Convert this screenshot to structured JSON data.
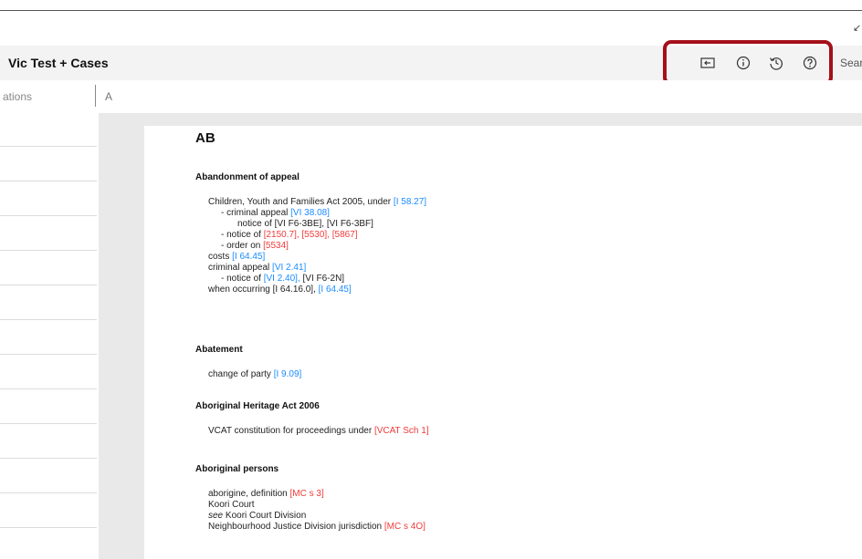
{
  "window": {
    "corner_glyph": "↙"
  },
  "header": {
    "title": "Vic Test + Cases",
    "search_placeholder": "Search"
  },
  "toolbar": {
    "icons": [
      "panel-toggle-icon",
      "info-icon",
      "history-icon",
      "help-icon"
    ],
    "highlight_color": "#a50f1a"
  },
  "tabs": {
    "left_label": "ations",
    "alpha_label": "A"
  },
  "colors": {
    "ref_blue": "#1a8cff",
    "ref_red": "#f23a3a"
  },
  "index": {
    "letter": "AB",
    "entries": [
      {
        "heading": "Abandonment of appeal",
        "lines": [
          {
            "indent": 0,
            "segments": [
              {
                "t": "Children, Youth and Families Act 2005, under "
              },
              {
                "t": "[I 58.27]",
                "c": "blue"
              }
            ]
          },
          {
            "indent": 1,
            "segments": [
              {
                "t": "- criminal appeal "
              },
              {
                "t": "[VI 38.08]",
                "c": "blue"
              }
            ]
          },
          {
            "indent": 2,
            "segments": [
              {
                "t": "notice of [VI F6-3BE], [VI F6-3BF]"
              }
            ]
          },
          {
            "indent": 1,
            "segments": [
              {
                "t": "- notice of "
              },
              {
                "t": "[2150.7],",
                "c": "red"
              },
              {
                "t": " "
              },
              {
                "t": "[5530],",
                "c": "red"
              },
              {
                "t": " "
              },
              {
                "t": "[5867]",
                "c": "red"
              }
            ]
          },
          {
            "indent": 1,
            "segments": [
              {
                "t": "- order on "
              },
              {
                "t": "[5534]",
                "c": "red"
              }
            ]
          },
          {
            "indent": 0,
            "segments": [
              {
                "t": "costs "
              },
              {
                "t": "[I 64.45]",
                "c": "blue"
              }
            ]
          },
          {
            "indent": 0,
            "segments": [
              {
                "t": "criminal appeal "
              },
              {
                "t": "[VI 2.41]",
                "c": "blue"
              }
            ]
          },
          {
            "indent": 1,
            "segments": [
              {
                "t": "- notice of "
              },
              {
                "t": "[VI 2.40],",
                "c": "blue"
              },
              {
                "t": " [VI F6-2N]"
              }
            ]
          },
          {
            "indent": 0,
            "segments": [
              {
                "t": "when occurring [I 64.16.0], "
              },
              {
                "t": "[I 64.45]",
                "c": "blue"
              }
            ]
          }
        ]
      },
      {
        "heading": "Abatement",
        "lines": [
          {
            "indent": 0,
            "segments": [
              {
                "t": "change of party "
              },
              {
                "t": "[I 9.09]",
                "c": "blue"
              }
            ]
          }
        ]
      },
      {
        "heading": "Aboriginal Heritage Act 2006",
        "lines": [
          {
            "indent": 0,
            "segments": [
              {
                "t": "VCAT constitution for proceedings under "
              },
              {
                "t": "[VCAT Sch 1]",
                "c": "red"
              }
            ]
          }
        ]
      },
      {
        "heading": "Aboriginal persons",
        "lines": [
          {
            "indent": 0,
            "segments": [
              {
                "t": "aborigine, definition "
              },
              {
                "t": "[MC s 3]",
                "c": "red"
              }
            ]
          },
          {
            "indent": 0,
            "segments": [
              {
                "t": "Koori Court"
              }
            ]
          },
          {
            "indent": 0,
            "segments": [
              {
                "t": "see",
                "i": true
              },
              {
                "t": "  Koori Court Division"
              }
            ]
          },
          {
            "indent": 0,
            "segments": [
              {
                "t": "Neighbourhood Justice Division jurisdiction "
              },
              {
                "t": "[MC s 4O]",
                "c": "red"
              }
            ]
          }
        ]
      }
    ]
  }
}
